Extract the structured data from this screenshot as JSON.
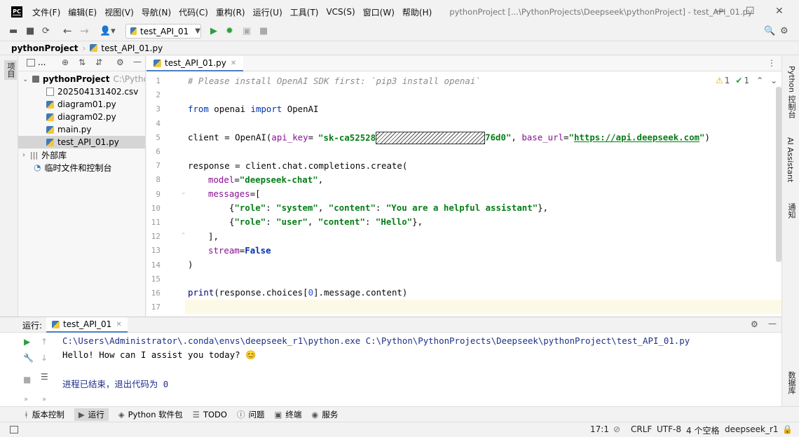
{
  "app": {
    "logo": "PC",
    "window_title": "pythonProject [...\\PythonProjects\\Deepseek\\pythonProject] - test_API_01.py",
    "menu": [
      "文件(F)",
      "编辑(E)",
      "视图(V)",
      "导航(N)",
      "代码(C)",
      "重构(R)",
      "运行(U)",
      "工具(T)",
      "VCS(S)",
      "窗口(W)",
      "帮助(H)"
    ]
  },
  "toolbar": {
    "run_config": "test_API_01"
  },
  "breadcrumb": {
    "project": "pythonProject",
    "file": "test_API_01.py"
  },
  "left_strip": {
    "project_tab": "项目",
    "bookmarks_tab": "书签",
    "structure_tab": "结构"
  },
  "project_tree": {
    "toolbar_label": "...",
    "root": "pythonProject",
    "root_path": "C:\\Python\\",
    "files": [
      "202504131402.csv",
      "diagram01.py",
      "diagram02.py",
      "main.py",
      "test_API_01.py"
    ],
    "external_libs": "外部库",
    "scratches": "临时文件和控制台"
  },
  "editor": {
    "tab": "test_API_01.py",
    "inspections": {
      "warnings": "1",
      "weak_warnings": "1"
    },
    "lines": {
      "l1": "# Please install OpenAI SDK first: `pip3 install openai`",
      "l3_kw1": "from",
      "l3_mod": " openai ",
      "l3_kw2": "import",
      "l3_name": " OpenAI",
      "l5_a": "client = OpenAI(",
      "l5_p1": "api_key",
      "l5_eq": "=",
      "l5_key_start": "\"sk-ca52528",
      "l5_key_end": "76d0\"",
      "l5_b": ", ",
      "l5_p2": "base_url",
      "l5_c": "=",
      "l5_q1": "\"",
      "l5_url": "https://api.deepseek.com",
      "l5_q2": "\"",
      "l5_d": ")",
      "l7": "response = client.chat.completions.create(",
      "l8_p": "model",
      "l8_eq": "=",
      "l8_v": "\"deepseek-chat\"",
      "l8_end": ",",
      "l9_p": "messages",
      "l9_end": "=[",
      "l10_a": "{",
      "l10_k1": "\"role\"",
      "l10_s1": ": ",
      "l10_v1": "\"system\"",
      "l10_s2": ", ",
      "l10_k2": "\"content\"",
      "l10_s3": ": ",
      "l10_v2": "\"You are a helpful assistant\"",
      "l10_b": "},",
      "l11_a": "{",
      "l11_k1": "\"role\"",
      "l11_s1": ": ",
      "l11_v1": "\"user\"",
      "l11_s2": ", ",
      "l11_k2": "\"content\"",
      "l11_s3": ": ",
      "l11_v2": "\"Hello\"",
      "l11_b": "},",
      "l12": "],",
      "l13_p": "stream",
      "l13_eq": "=",
      "l13_v": "False",
      "l14": ")",
      "l16_fn": "print",
      "l16_a": "(response.choices[",
      "l16_n": "0",
      "l16_b": "].message.content)"
    },
    "line_numbers": [
      "1",
      "2",
      "3",
      "4",
      "5",
      "6",
      "7",
      "8",
      "9",
      "10",
      "11",
      "12",
      "13",
      "14",
      "15",
      "16",
      "17"
    ]
  },
  "right_strip": {
    "python_console": "Python 控制台",
    "ai_assistant": "AI Assistant",
    "notifications": "通知",
    "database": "数据库"
  },
  "run_panel": {
    "label": "运行:",
    "tab": "test_API_01",
    "output": [
      "C:\\Users\\Administrator\\.conda\\envs\\deepseek_r1\\python.exe C:\\Python\\PythonProjects\\Deepseek\\pythonProject\\test_API_01.py",
      "Hello! How can I assist you today? 😊",
      "进程已结束，退出代码为 0"
    ]
  },
  "bottom_tabs": [
    "版本控制",
    "运行",
    "Python 软件包",
    "TODO",
    "问题",
    "终端",
    "服务"
  ],
  "status": {
    "position": "17:1",
    "line_sep": "CRLF",
    "encoding": "UTF-8",
    "indent": "4 个空格",
    "interpreter": "deepseek_r1"
  },
  "colors": {
    "keyword": "#0033b3",
    "string": "#067d17",
    "param": "#871094",
    "comment": "#8c8c8c",
    "run_green": "#2e9e3e",
    "tab_underline": "#4a7ec2"
  }
}
